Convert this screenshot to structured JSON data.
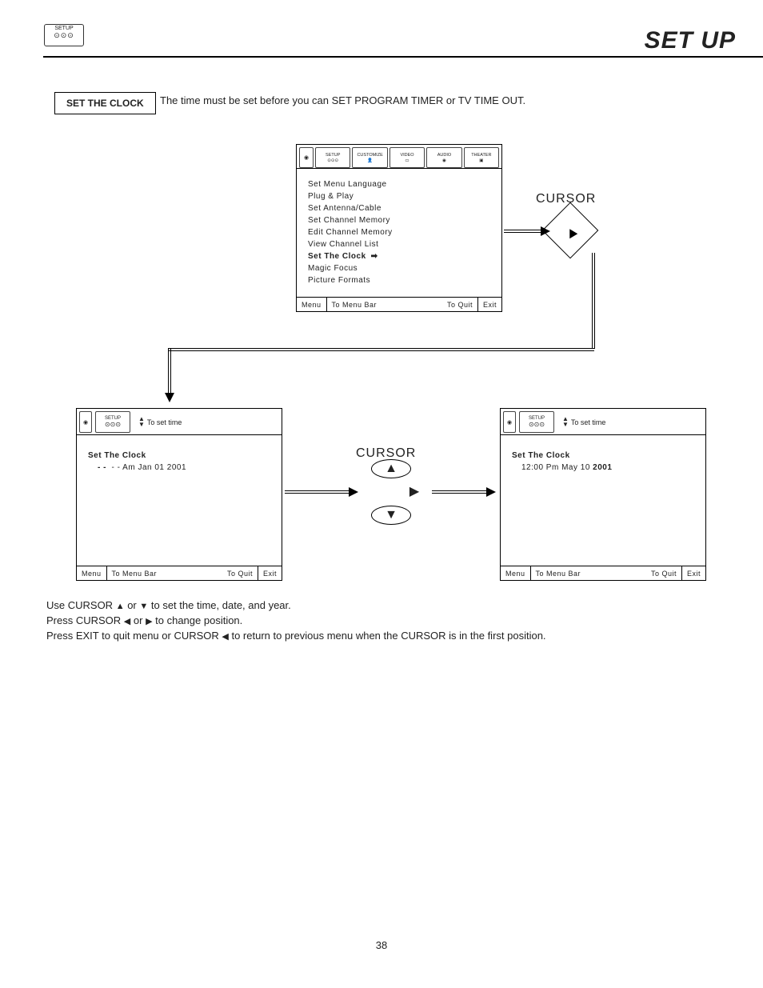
{
  "header": {
    "setup_tab_label": "SETUP",
    "page_title": "SET UP"
  },
  "section": {
    "box_label": "SET THE CLOCK",
    "intro": "The time must be set before you can  SET PROGRAM TIMER or TV TIME OUT."
  },
  "osd_top": {
    "tabs": [
      "SETUP",
      "CUSTOMIZE",
      "VIDEO",
      "AUDIO",
      "THEATER"
    ],
    "items": [
      "Set Menu Language",
      "Plug & Play",
      "Set Antenna/Cable",
      "Set Channel Memory",
      "Edit Channel Memory",
      "View Channel List",
      "Set The Clock",
      "Magic Focus",
      "Picture Formats"
    ],
    "selected_index": 6,
    "foot": {
      "menu": "Menu",
      "to_menu_bar": "To Menu Bar",
      "to_quit": "To Quit",
      "exit": "Exit"
    }
  },
  "cursor_label": "CURSOR",
  "osd_left": {
    "tab": "SETUP",
    "hint": "To set time",
    "title": "Set The Clock",
    "value": "- -  - - Am Jan 01 2001",
    "foot": {
      "menu": "Menu",
      "to_menu_bar": "To Menu Bar",
      "to_quit": "To Quit",
      "exit": "Exit"
    }
  },
  "osd_right": {
    "tab": "SETUP",
    "hint": "To set time",
    "title": "Set The Clock",
    "value": "12:00 Pm May 10 2001",
    "value_bold_part": "2001",
    "foot": {
      "menu": "Menu",
      "to_menu_bar": "To Menu Bar",
      "to_quit": "To Quit",
      "exit": "Exit"
    }
  },
  "instructions": {
    "l1a": "Use CURSOR ",
    "l1b": " or ",
    "l1c": " to set the time, date, and year.",
    "l2a": "Press CURSOR ",
    "l2b": " or ",
    "l2c": " to change position.",
    "l3a": "Press EXIT to quit menu or CURSOR ",
    "l3b": " to return to previous menu when the CURSOR is in the first position."
  },
  "page_number": "38"
}
